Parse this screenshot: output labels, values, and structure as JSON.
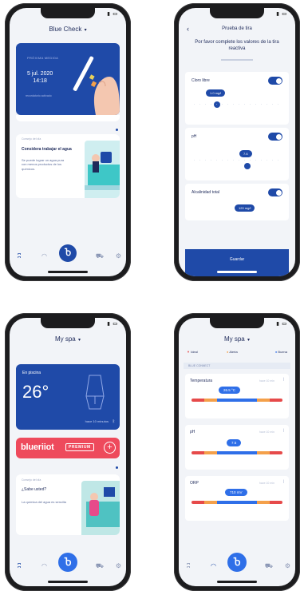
{
  "status": {
    "time": "",
    "signal": "▮",
    "battery": "▭"
  },
  "screen1": {
    "header": {
      "title": "Blue Check",
      "chevron": "▾"
    },
    "measurement_card": {
      "label": "PRÓXIMA MEDIDA",
      "date": "5 jul. 2020",
      "time": "14:18",
      "footer": "recordatorio activado"
    },
    "tip_card": {
      "label": "Consejo del día",
      "title": "Considera trabajar el agua",
      "description": "Se puede lograr un agua pura con menos productos de los químicos."
    },
    "tabbar": {
      "items": [
        {
          "icon": "pool-icon",
          "glyph": "ʭ"
        },
        {
          "icon": "gauge-icon",
          "glyph": "◠"
        },
        {
          "icon": "blue-button",
          "glyph": "Ⴆ"
        },
        {
          "icon": "shop-icon",
          "glyph": "⛟"
        },
        {
          "icon": "settings-icon",
          "glyph": "⚙"
        }
      ]
    }
  },
  "screen2": {
    "back": "‹",
    "title": "Prueba de tira",
    "subtitle": "Por favor complete los valores de la tira reactiva",
    "params": [
      {
        "name": "Cloro libre",
        "value": "1.0 mg/l",
        "enabled": true
      },
      {
        "name": "pH",
        "value": "7.6",
        "enabled": true
      },
      {
        "name": "Alcalinidad total",
        "value": "120 mg/l",
        "enabled": true
      }
    ],
    "save_label": "Guardar"
  },
  "screen3": {
    "header": {
      "title": "My spa",
      "chevron": "▾"
    },
    "pool_card": {
      "subtitle": "En piscina",
      "temperature": "26°",
      "updated": "hace 10 minutos",
      "bt": "ᛒ"
    },
    "premium": {
      "brand": "blueriiot",
      "tag": "PREMIUM",
      "plus": "+"
    },
    "tip_card": {
      "label": "Consejo del día",
      "title": "¿Sabe usted?",
      "description": "La química del agua es sencilla"
    }
  },
  "screen4": {
    "header": {
      "title": "My spa",
      "chevron": "▾"
    },
    "legend": [
      {
        "label": "Ideal",
        "color": "#e64a4a"
      },
      {
        "label": "Alerta",
        "color": "#f4a04a"
      },
      {
        "label": "Buena",
        "color": "#2f6fe8"
      }
    ],
    "section_label": "BLUE CONNECT",
    "measurements": [
      {
        "name": "Temperatura",
        "time": "hace 10 min",
        "value": "26.5 °C"
      },
      {
        "name": "pH",
        "time": "hace 10 min",
        "value": "7.5"
      },
      {
        "name": "ORP",
        "time": "hace 10 min",
        "value": "710 mV"
      }
    ]
  }
}
